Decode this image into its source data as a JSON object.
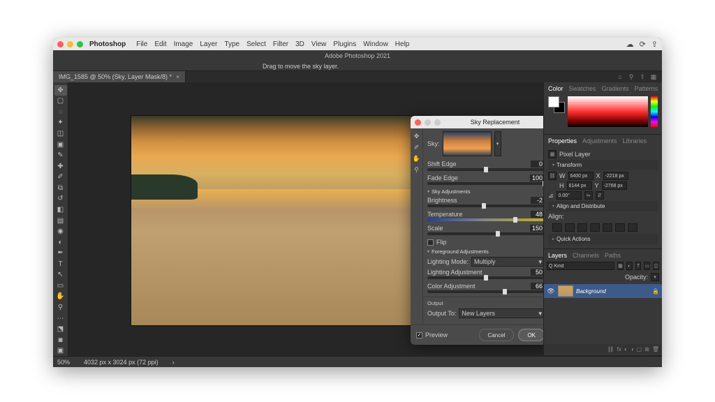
{
  "mac": {
    "app": "Photoshop",
    "menus": [
      "File",
      "Edit",
      "Image",
      "Layer",
      "Type",
      "Select",
      "Filter",
      "3D",
      "View",
      "Plugins",
      "Window",
      "Help"
    ]
  },
  "appTitle": "Adobe Photoshop 2021",
  "hint": "Drag to move the sky layer.",
  "tab": {
    "title": "IMG_1585 @ 50% (Sky, Layer Mask/8) *"
  },
  "status": {
    "zoom": "50%",
    "dim": "4032 px x 3024 px (72 ppi)"
  },
  "dialog": {
    "title": "Sky Replacement",
    "skyLabel": "Sky:",
    "shiftEdge": {
      "label": "Shift Edge",
      "value": "0",
      "pos": 50
    },
    "fadeEdge": {
      "label": "Fade Edge",
      "value": "100",
      "pos": 100
    },
    "secSky": "Sky Adjustments",
    "brightness": {
      "label": "Brightness",
      "value": "-2",
      "pos": 48
    },
    "temperature": {
      "label": "Temperature",
      "value": "48",
      "pos": 75
    },
    "scale": {
      "label": "Scale",
      "value": "150",
      "pos": 60
    },
    "flip": "Flip",
    "secFg": "Foreground Adjustments",
    "lightingModeLabel": "Lighting Mode:",
    "lightingMode": "Multiply",
    "lightingAdj": {
      "label": "Lighting Adjustment",
      "value": "50",
      "pos": 50
    },
    "colorAdj": {
      "label": "Color Adjustment",
      "value": "66",
      "pos": 66
    },
    "outputHeader": "Output",
    "outputToLabel": "Output To:",
    "outputTo": "New Layers",
    "preview": "Preview",
    "cancel": "Cancel",
    "ok": "OK"
  },
  "panels": {
    "colorTabs": [
      "Color",
      "Swatches",
      "Gradients",
      "Patterns"
    ],
    "propTabs": [
      "Properties",
      "Adjustments",
      "Libraries"
    ],
    "pixelLayer": "Pixel Layer",
    "transform": "Transform",
    "w": "6400 px",
    "x": "-2218 px",
    "h": "6144 px",
    "y": "-2768 px",
    "angle": "0.00°",
    "alignHeader": "Align and Distribute",
    "alignLabel": "Align:",
    "quick": "Quick Actions",
    "layerTabs": [
      "Layers",
      "Channels",
      "Paths"
    ],
    "kind": "Q Kind",
    "opacity": "Opacity:",
    "bgLayer": "Background"
  }
}
